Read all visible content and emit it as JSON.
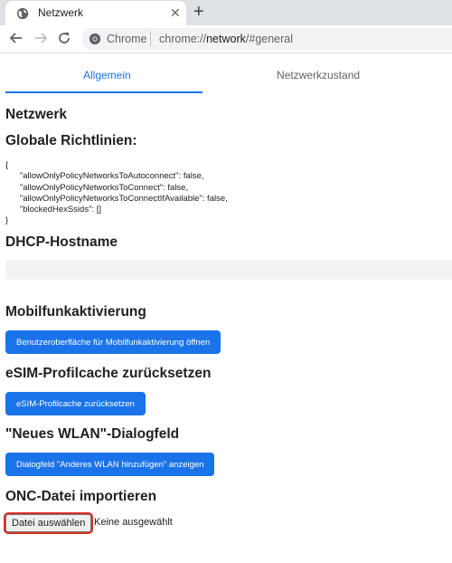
{
  "browser": {
    "tab_title": "Netzwerk",
    "new_tab_symbol": "+",
    "close_symbol": "✕",
    "omnibox_scheme_label": "Chrome",
    "url_prefix": "chrome://",
    "url_host": "network",
    "url_suffix": "/#general"
  },
  "page_tabs": [
    {
      "label": "Allgemein",
      "active": true
    },
    {
      "label": "Netzwerkzustand",
      "active": false
    }
  ],
  "sections": {
    "network_heading": "Netzwerk",
    "global_policies_heading": "Globale Richtlinien:",
    "global_policies_text": "{\n      \"allowOnlyPolicyNetworksToAutoconnect\": false,\n      \"allowOnlyPolicyNetworksToConnect\": false,\n      \"allowOnlyPolicyNetworksToConnectIfAvailable\": false,\n      \"blockedHexSsids\": []\n}",
    "dhcp_heading": "DHCP-Hostname",
    "dhcp_value": "",
    "mobile_heading": "Mobilfunkaktivierung",
    "mobile_button": "Benutzeroberfläche für Mobilfunkaktivierung öffnen",
    "esim_heading": "eSIM-Profilcache zurücksetzen",
    "esim_button": "eSIM-Profilcache zurücksetzen",
    "wlan_heading": "\"Neues WLAN\"-Dialogfeld",
    "wlan_button": "Dialogfeld \"Anderes WLAN hinzufügen\" anzeigen",
    "onc_heading": "ONC-Datei importieren",
    "file_button": "Datei auswählen",
    "file_status": "Keine ausgewählt"
  },
  "colors": {
    "accent": "#1a73e8",
    "focus_ring": "#d93025"
  },
  "icons": [
    "globe-icon",
    "close-icon",
    "plus-icon",
    "back-arrow-icon",
    "forward-arrow-icon",
    "reload-icon",
    "chrome-site-icon"
  ]
}
